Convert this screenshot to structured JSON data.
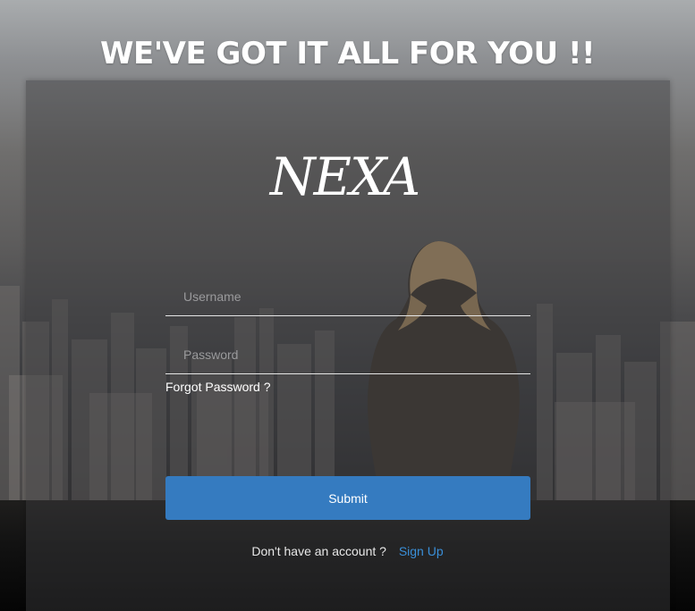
{
  "headline": "WE'VE GOT IT ALL FOR YOU !!",
  "logo": {
    "text": "NEXA"
  },
  "form": {
    "username": {
      "placeholder": "Username",
      "value": ""
    },
    "password": {
      "placeholder": "Password",
      "value": ""
    },
    "forgot_label": "Forgot Password ?",
    "submit_label": "Submit"
  },
  "signup": {
    "prompt": "Don't have an account ?",
    "link_label": "Sign Up"
  },
  "colors": {
    "accent": "#357bc0",
    "link": "#3a8fd8"
  }
}
